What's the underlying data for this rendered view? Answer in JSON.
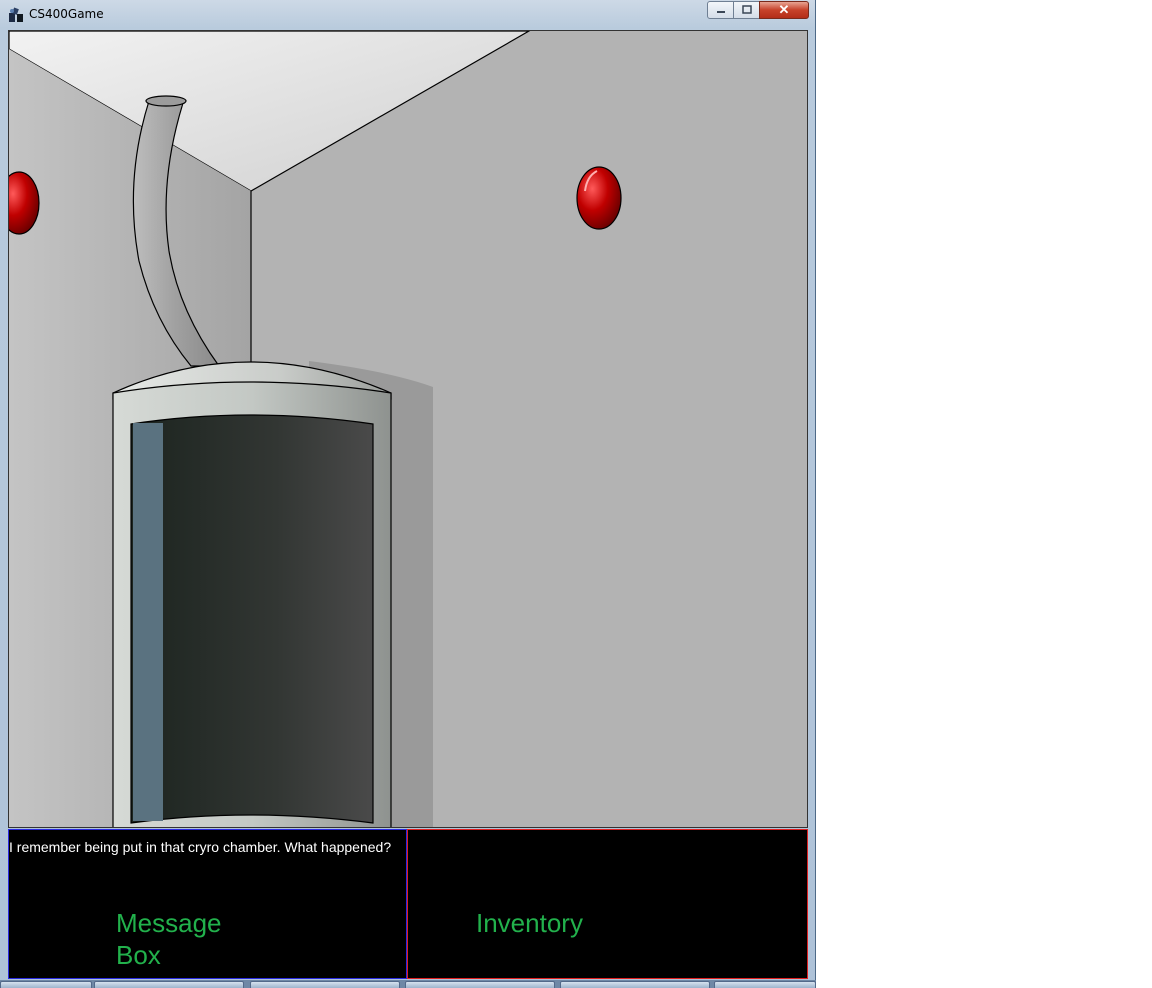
{
  "window": {
    "title": "CS400Game",
    "minimize_label": "▭",
    "maximize_label": "□",
    "close_label": "✕"
  },
  "scene": {
    "description_icons": [
      "cryo-chamber-icon",
      "pipe-icon",
      "red-wall-button-icon"
    ],
    "colors": {
      "wall": "#b3b3b3",
      "ceiling": "#e6e6e6",
      "button_red": "#c00000",
      "chamber_glass": "#2a2f2b"
    }
  },
  "message_box": {
    "text": "I remember being put in that cryro chamber. What happened?",
    "label": "Message Box",
    "border_color": "#2a2ae0",
    "label_color": "#22b14c"
  },
  "inventory": {
    "label": "Inventory",
    "border_color": "#e02020",
    "label_color": "#22b14c"
  }
}
